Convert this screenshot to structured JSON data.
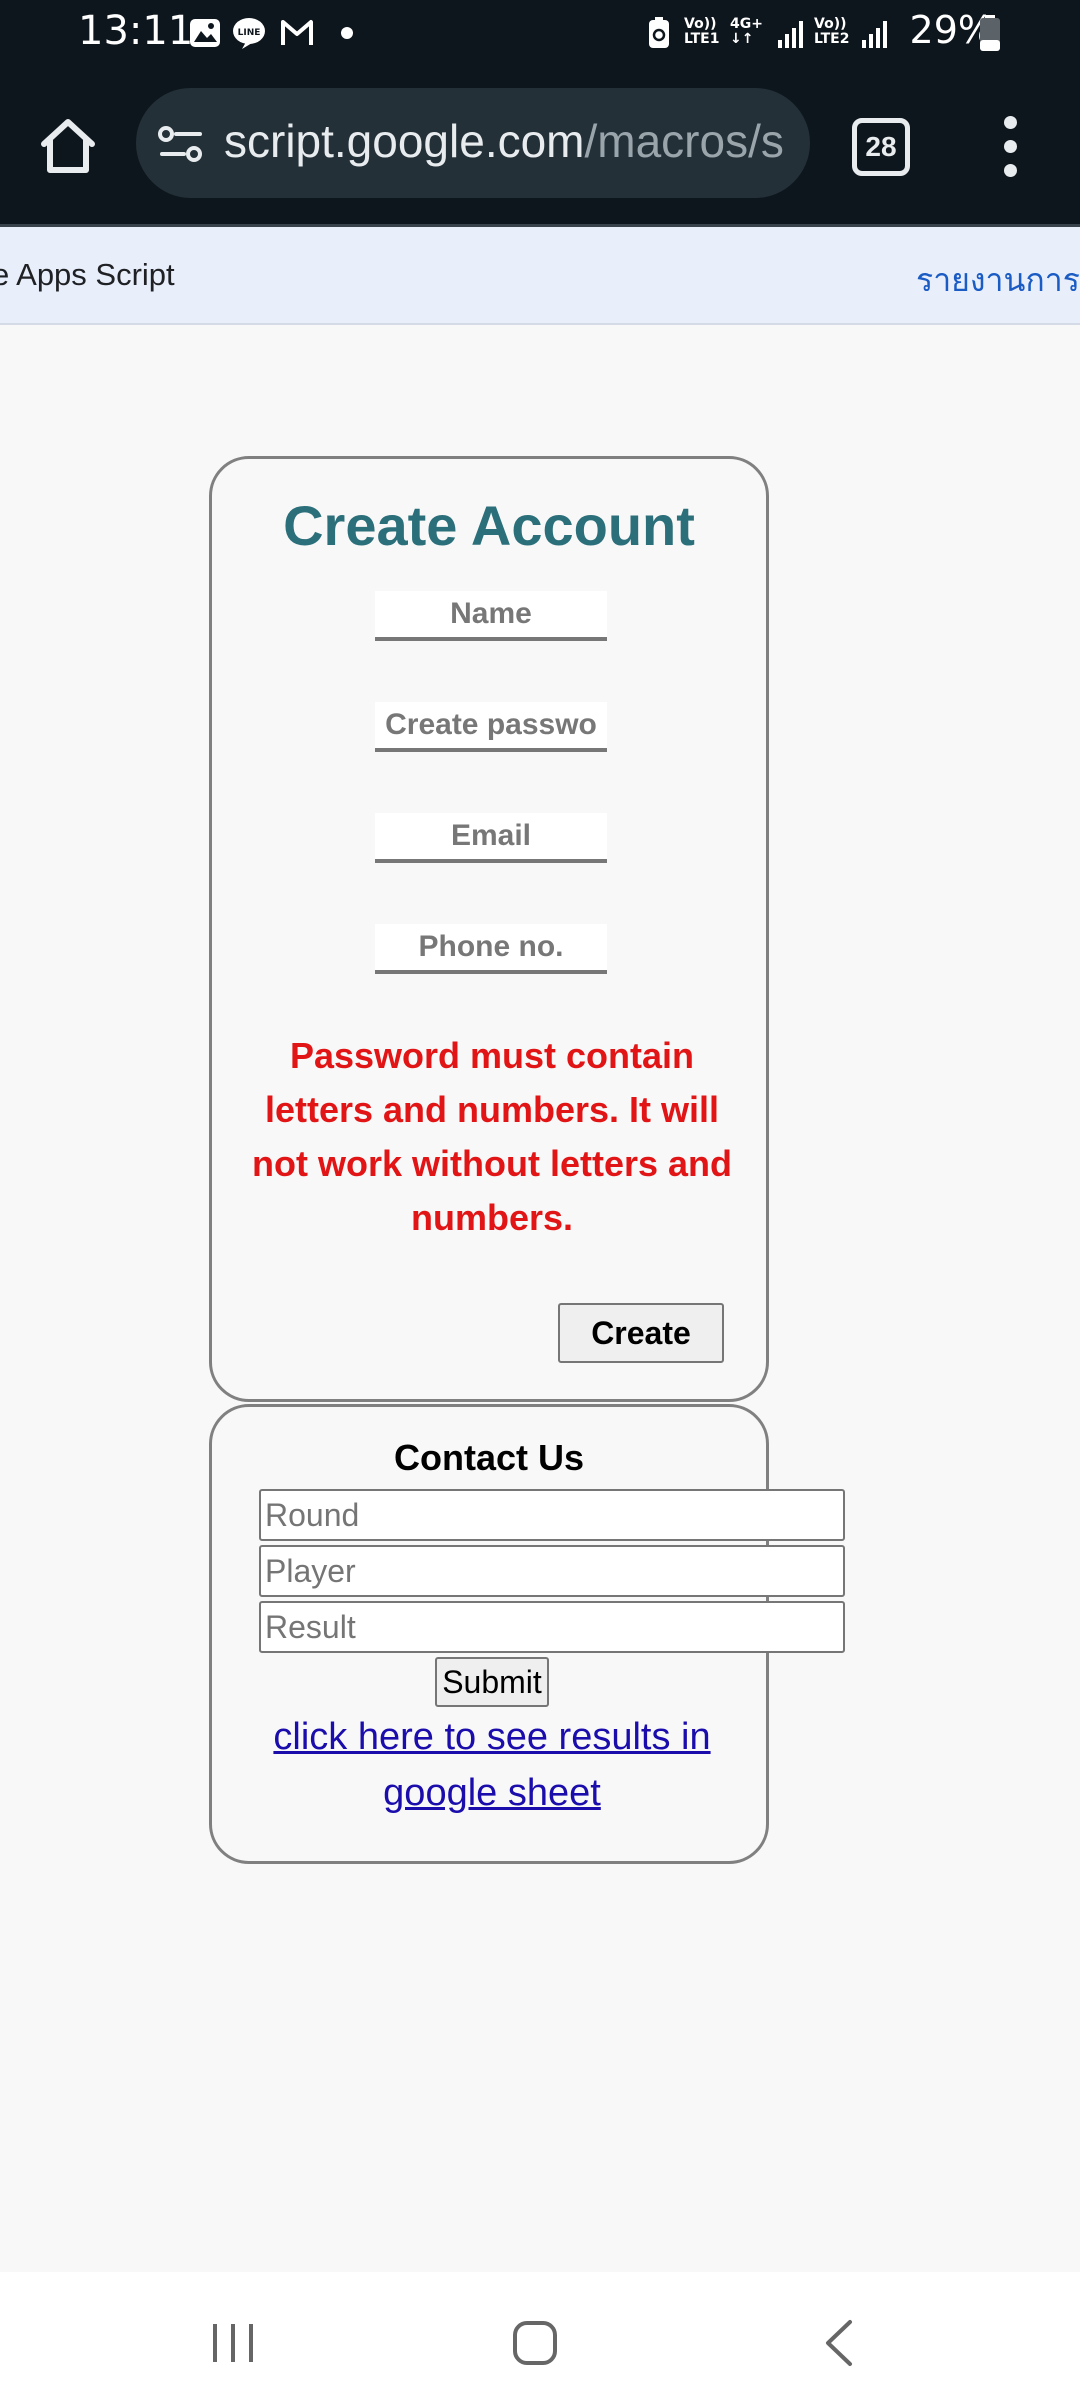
{
  "status_bar": {
    "time": "13:11",
    "battery": "29%",
    "notification_icons": [
      "gallery-icon",
      "line-icon",
      "gmail-icon",
      "dot-icon"
    ],
    "network": {
      "sim1": "LTE1",
      "sim1_volte": "Vo))",
      "data": "4G+",
      "sim2": "LTE2",
      "sim2_volte": "Vo))"
    }
  },
  "browser": {
    "url_host": "script.google.com",
    "url_path": "/macros/s",
    "tab_count": "28"
  },
  "banner": {
    "title": "e Apps Script",
    "report_link": "รายงานการล"
  },
  "create_account": {
    "title": "Create Account",
    "name_placeholder": "Name",
    "password_placeholder": "Create passwo",
    "email_placeholder": "Email",
    "phone_placeholder": "Phone no.",
    "warning": "Password must contain letters and numbers. It will not work without letters and numbers.",
    "create_button": "Create"
  },
  "contact": {
    "title": "Contact Us",
    "round_placeholder": "Round",
    "player_placeholder": "Player",
    "result_placeholder": "Result",
    "submit_button": "Submit",
    "results_link": "click here to see results in google sheet"
  },
  "colors": {
    "title_teal": "#2b6f7a",
    "warning_red": "#e11515",
    "link_blue": "#1a0dab",
    "banner_bg": "#e8effb"
  }
}
